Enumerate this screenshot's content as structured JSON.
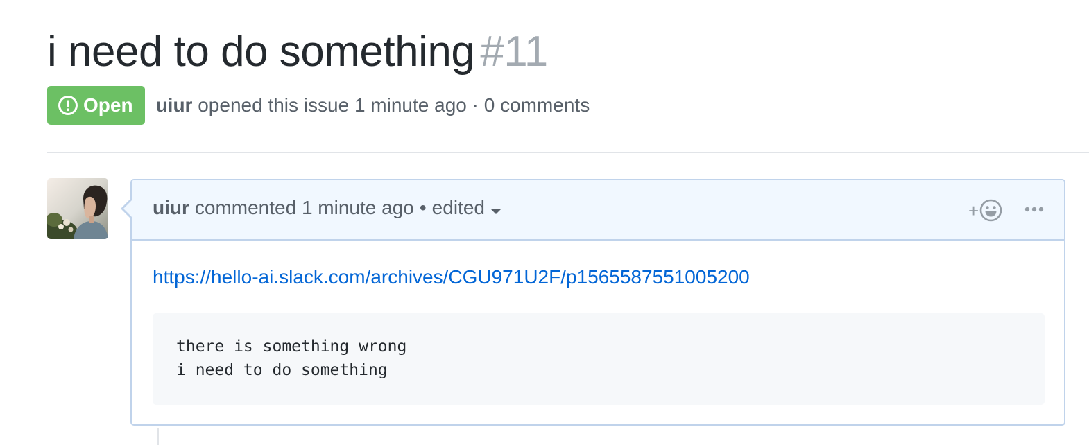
{
  "issue": {
    "title": "i need to do something",
    "number": "#11",
    "state": "Open",
    "state_icon": "issue-opened-icon",
    "author": "uiur",
    "opened_text": "opened this issue 1 minute ago · 0 comments"
  },
  "comment": {
    "author": "uiur",
    "action_text": "commented 1 minute ago",
    "separator": "•",
    "edited_label": "edited",
    "reaction_plus": "+",
    "reaction_icon": "smiley-icon",
    "more_icon": "kebab-horizontal-icon",
    "link_text": "https://hello-ai.slack.com/archives/CGU971U2F/p1565587551005200",
    "code": "there is something wrong\ni need to do something"
  },
  "colors": {
    "open_badge": "#6cc064",
    "link": "#0366d6",
    "header_bg": "#f1f8ff",
    "border": "#c0d3eb"
  }
}
